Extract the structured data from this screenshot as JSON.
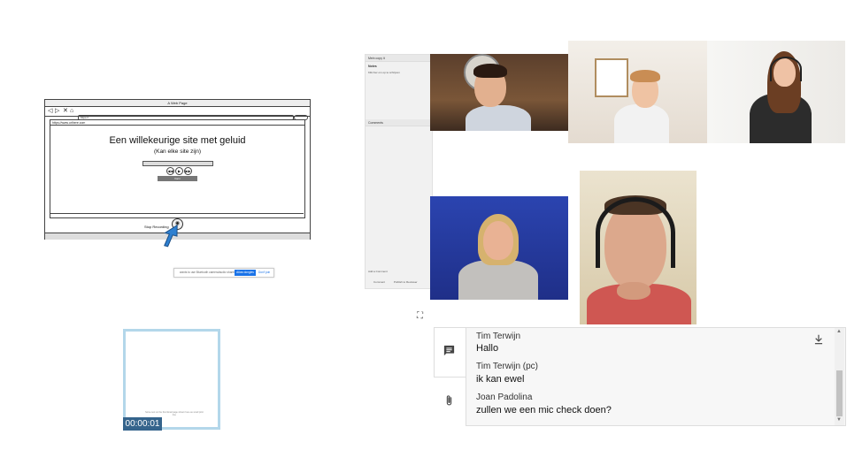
{
  "wireframe": {
    "window_title": "A Web Page",
    "url_text": "https://",
    "address_text": "https://www.urlhere.com",
    "heading": "Een willekeurige site met geluid",
    "subheading": "(Kan elke site zijn)",
    "play_symbols": [
      "◀◀",
      "▶",
      "▶▶"
    ],
    "button_label": "Vorm",
    "stop_label": "Stop Recording",
    "rec_symbol": "◉"
  },
  "permission_bar": {
    "text": "wants to use Bluetooth camera/audio shares",
    "allow_label": "Allow dongles",
    "deny_label": "Don't join"
  },
  "thumbnail": {
    "caption": "Some text on the thumbnail page shown here as small print line",
    "timer": "00:00:01"
  },
  "doc_panel": {
    "title": "Mein copy it",
    "notes_label": "Notes",
    "notes_text": "Klik hier om op te schrijven",
    "comments_label": "Comments",
    "add_comment_label": "Add a Comment",
    "footer_left": "Comment",
    "footer_right": "Publish to Reviewer"
  },
  "icons": {
    "expand": "fullscreen-icon",
    "chat": "chat-icon",
    "attach": "paperclip-icon",
    "download": "download-icon"
  },
  "chat": {
    "messages": [
      {
        "name": "Tim Terwijn",
        "text": "Hallo"
      },
      {
        "name": "Tim Terwijn (pc)",
        "text": "ik kan ewel"
      },
      {
        "name": "Joan Padolina",
        "text": "zullen we een mic check doen?"
      }
    ]
  },
  "colors": {
    "timer_bg": "#35648c",
    "thumb_border": "#b3d7ea",
    "allow_button": "#1a73e8"
  }
}
